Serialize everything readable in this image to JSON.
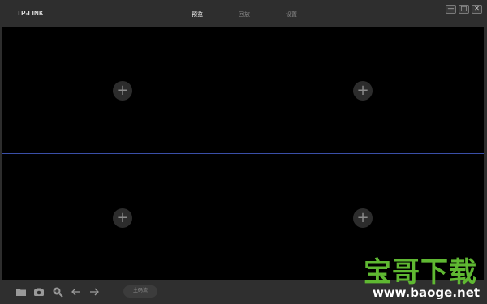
{
  "app": {
    "logo": "TP-LINK"
  },
  "tabs": [
    {
      "label": "预览",
      "active": true
    },
    {
      "label": "回放",
      "active": false
    },
    {
      "label": "设置",
      "active": false
    }
  ],
  "window_controls": [
    {
      "name": "minimize",
      "glyph": "—"
    },
    {
      "name": "maximize",
      "glyph": "□"
    },
    {
      "name": "close",
      "glyph": "✕"
    }
  ],
  "video_panes": [
    {
      "add_glyph": "+"
    },
    {
      "add_glyph": "+"
    },
    {
      "add_glyph": "+"
    },
    {
      "add_glyph": "+"
    }
  ],
  "toolbar": {
    "icons": [
      "folder-icon",
      "camera-icon",
      "zoom-in-icon",
      "arrow-left-icon",
      "arrow-right-icon"
    ],
    "stream_button": "主码流"
  },
  "watermark": {
    "title": "宝哥下载",
    "url": "www.baoge.net"
  },
  "colors": {
    "divider_active": "#3a4fa8",
    "watermark_green": "#5fb832"
  }
}
